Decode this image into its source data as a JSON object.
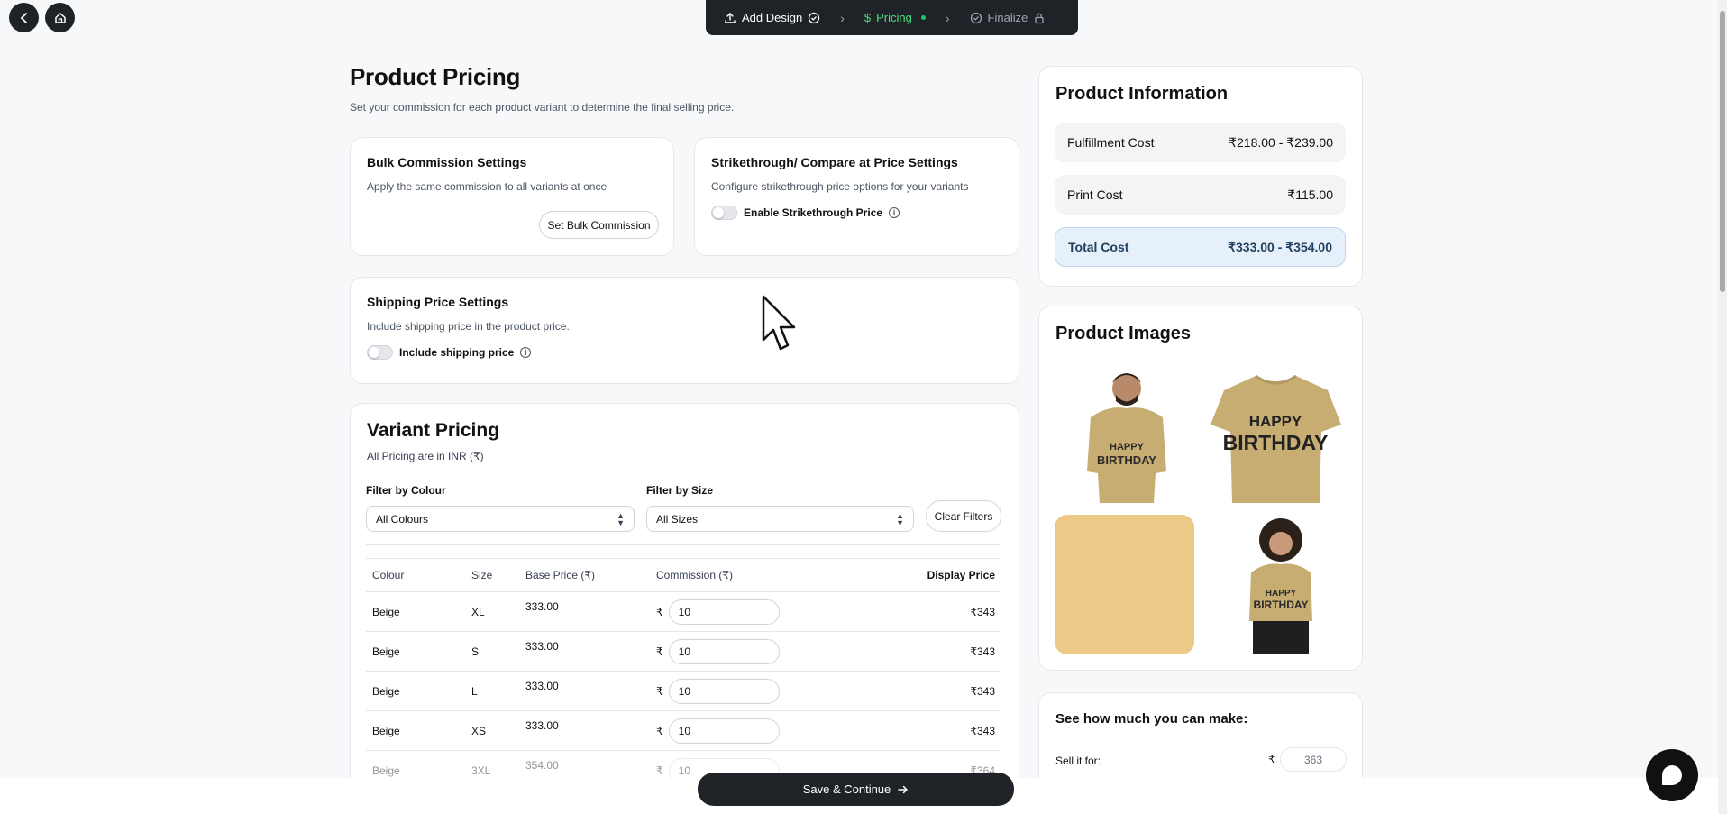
{
  "nav": {
    "back_icon": "chevron-left-icon",
    "home_icon": "home-icon"
  },
  "stepper": {
    "steps": [
      {
        "label": "Add Design",
        "icon": "upload-icon",
        "status_icon": "check-circle-icon"
      },
      {
        "label": "Pricing",
        "icon": "dollar-icon",
        "status_icon": "green-dot"
      },
      {
        "label": "Finalize",
        "icon": "check-circle-icon",
        "status_icon": "lock-icon"
      }
    ]
  },
  "header": {
    "title": "Product Pricing",
    "subtitle": "Set your commission for each product variant to determine the final selling price."
  },
  "bulk": {
    "title": "Bulk Commission Settings",
    "desc": "Apply the same commission to all variants at once",
    "button": "Set Bulk Commission"
  },
  "strike": {
    "title": "Strikethrough/ Compare at Price Settings",
    "desc": "Configure strikethrough price options for your variants",
    "toggle_label": "Enable Strikethrough Price"
  },
  "shipping": {
    "title": "Shipping Price Settings",
    "desc": "Include shipping price in the product price.",
    "toggle_label": "Include shipping price"
  },
  "variants": {
    "title": "Variant Pricing",
    "note": "All Pricing are in INR (₹)",
    "filter_colour_label": "Filter by Colour",
    "filter_colour_value": "All Colours",
    "filter_size_label": "Filter by Size",
    "filter_size_value": "All Sizes",
    "clear_filters": "Clear Filters",
    "headers": [
      "Colour",
      "Size",
      "Base Price (₹)",
      "Commission (₹)",
      "Display Price"
    ],
    "currency": "₹",
    "rows": [
      {
        "colour": "Beige",
        "size": "XL",
        "base": "333.00",
        "commission": "10",
        "display": "₹343"
      },
      {
        "colour": "Beige",
        "size": "S",
        "base": "333.00",
        "commission": "10",
        "display": "₹343"
      },
      {
        "colour": "Beige",
        "size": "L",
        "base": "333.00",
        "commission": "10",
        "display": "₹343"
      },
      {
        "colour": "Beige",
        "size": "XS",
        "base": "333.00",
        "commission": "10",
        "display": "₹343"
      },
      {
        "colour": "Beige",
        "size": "3XL",
        "base": "354.00",
        "commission": "10",
        "display": "₹364"
      }
    ]
  },
  "info": {
    "title": "Product Information",
    "fulfillment_label": "Fulfillment Cost",
    "fulfillment_value": "₹218.00 - ₹239.00",
    "print_label": "Print Cost",
    "print_value": "₹115.00",
    "total_label": "Total Cost",
    "total_value": "₹333.00 - ₹354.00"
  },
  "images": {
    "title": "Product Images",
    "tile_text_1": "HAPPY",
    "tile_text_2": "BIRTHDAY"
  },
  "earn": {
    "title": "See how much you can make:",
    "sell_label": "Sell it for:",
    "currency": "₹",
    "sell_value": "363"
  },
  "footer": {
    "save_label": "Save & Continue",
    "save_icon": "arrow-right-icon"
  },
  "colors": {
    "dark": "#1f2328",
    "accent_green": "#4ade80",
    "total_bg": "#e6f0fb",
    "tshirt": "#c8ad73",
    "tile_beige": "#ecc986"
  }
}
